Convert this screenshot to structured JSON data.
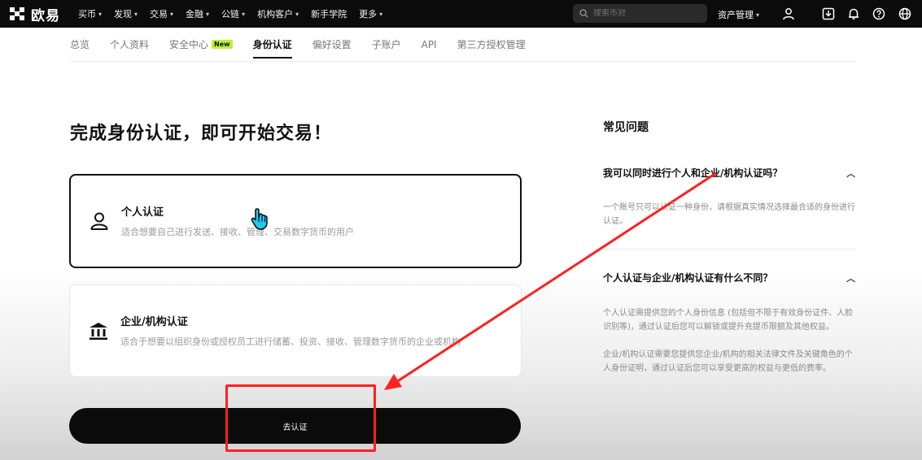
{
  "brand": {
    "name": "欧易"
  },
  "nav": {
    "items": [
      {
        "label": "买币",
        "has_dropdown": true
      },
      {
        "label": "发现",
        "has_dropdown": true
      },
      {
        "label": "交易",
        "has_dropdown": true
      },
      {
        "label": "金融",
        "has_dropdown": true
      },
      {
        "label": "公链",
        "has_dropdown": true
      },
      {
        "label": "机构客户",
        "has_dropdown": true
      },
      {
        "label": "新手学院",
        "has_dropdown": false
      },
      {
        "label": "更多",
        "has_dropdown": true
      }
    ],
    "search_placeholder": "搜索币对",
    "asset_label": "资产管理",
    "icons": [
      "user-icon",
      "download-icon",
      "bell-icon",
      "help-icon",
      "globe-icon"
    ]
  },
  "tabs": [
    {
      "label": "总览",
      "active": false
    },
    {
      "label": "个人资料",
      "active": false
    },
    {
      "label": "安全中心",
      "active": false,
      "badge": "New"
    },
    {
      "label": "身份认证",
      "active": true
    },
    {
      "label": "偏好设置",
      "active": false
    },
    {
      "label": "子账户",
      "active": false
    },
    {
      "label": "API",
      "active": false
    },
    {
      "label": "第三方授权管理",
      "active": false
    }
  ],
  "main": {
    "title": "完成身份认证，即可开始交易！",
    "personal": {
      "title": "个人认证",
      "desc": "适合想要自己进行发送、接收、管理、交易数字货币的用户",
      "selected": true
    },
    "business": {
      "title": "企业/机构认证",
      "desc": "适合于想要以组织身份或授权员工进行储蓄、投资、接收、管理数字货币的企业或机构",
      "selected": false
    },
    "cta": "去认证"
  },
  "faq": {
    "title": "常见问题",
    "items": [
      {
        "q": "我可以同时进行个人和企业/机构认证吗？",
        "a": "一个账号只可以认证一种身份，请根据真实情况选择最合适的身份进行认证。"
      },
      {
        "q": "个人认证与企业/机构认证有什么不同？",
        "a": "个人认证需提供您的个人身份信息 (包括但不限于有效身份证件、人脸识别等)，通过认证后您可以解锁或提升充提币限额及其他权益。",
        "a2": "企业/机构认证需要您提供您企业/机构的相关法律文件及关键角色的个人身份证明，通过认证后您可以享受更高的权益与更低的费率。"
      }
    ]
  },
  "colors": {
    "nav_bg": "#0b0b0b",
    "accent_badge": "#b8f23a",
    "annotation_red": "#ff2020"
  }
}
